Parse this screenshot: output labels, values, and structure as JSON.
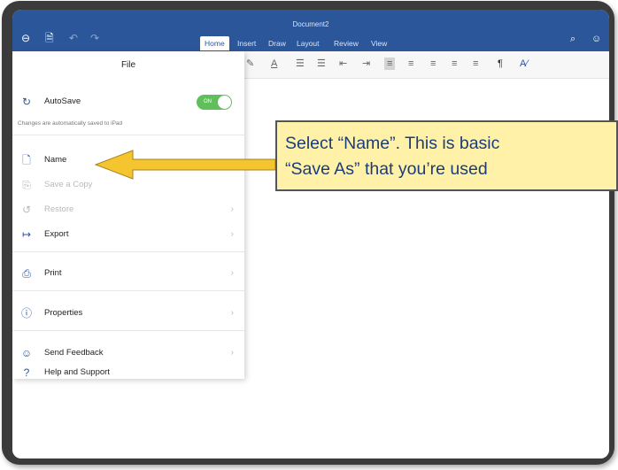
{
  "ribbon": {
    "title": "Document2",
    "tabs": [
      {
        "label": "Home"
      },
      {
        "label": "Insert"
      },
      {
        "label": "Draw"
      },
      {
        "label": "Layout"
      },
      {
        "label": "Review"
      },
      {
        "label": "View"
      }
    ],
    "colors": {
      "ribbon": "#2b579a"
    }
  },
  "file_panel": {
    "title": "File",
    "autosave": {
      "label": "AutoSave",
      "state": "ON",
      "hint": "Changes are automatically saved to iPad"
    },
    "items": [
      {
        "label": "Name",
        "icon": "document-icon",
        "disabled": false
      },
      {
        "label": "Save a Copy",
        "icon": "copy-icon",
        "disabled": true
      },
      {
        "label": "Restore",
        "icon": "restore-icon",
        "disabled": true
      },
      {
        "label": "Export",
        "icon": "export-icon",
        "disabled": false
      },
      {
        "label": "Print",
        "icon": "printer-icon",
        "disabled": false
      },
      {
        "label": "Properties",
        "icon": "info-icon",
        "disabled": false
      },
      {
        "label": "Send Feedback",
        "icon": "feedback-icon",
        "disabled": false
      },
      {
        "label": "Help and Support",
        "icon": "help-icon",
        "disabled": false
      }
    ]
  },
  "callout": {
    "line1": "Select “Name”. This is basic",
    "line2": "“Save As” that you’re used"
  }
}
